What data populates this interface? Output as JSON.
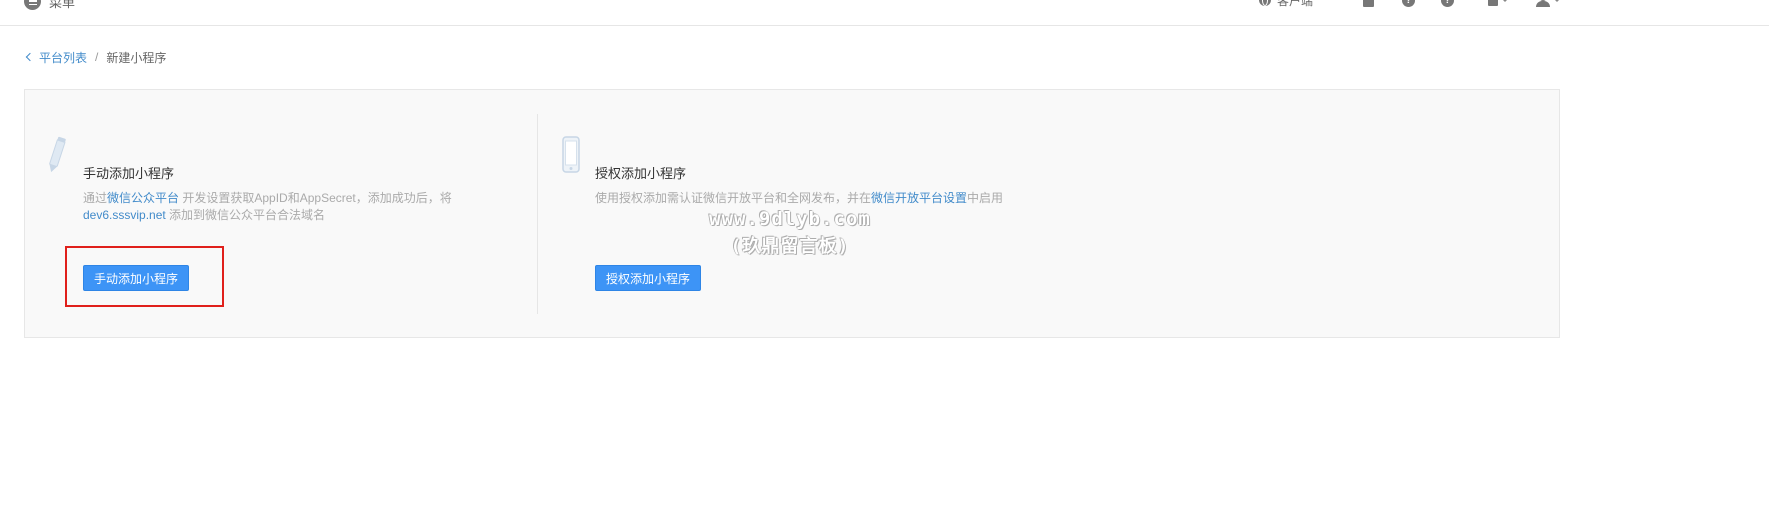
{
  "topbar": {
    "menu_label": "菜单",
    "client_label": "客户端",
    "icons": [
      "menu-icon",
      "globe-icon",
      "calculator-icon",
      "help-icon",
      "help-icon",
      "bell-icon",
      "user-icon"
    ]
  },
  "breadcrumb": {
    "back_label": "平台列表",
    "separator": "/",
    "current": "新建小程序"
  },
  "cards": {
    "manual": {
      "title": "手动添加小程序",
      "desc_prefix": "通过",
      "link1": "微信公众平台",
      "desc_mid": " 开发设置获取AppID和AppSecret，添加成功后，将",
      "link2": "dev6.sssvip.net",
      "desc_suffix": " 添加到微信公众平台合法域名",
      "button": "手动添加小程序",
      "icon": "pencil-icon"
    },
    "auth": {
      "title": "授权添加小程序",
      "desc_prefix": "使用授权添加需认证微信开放平台和全网发布，并在",
      "link": "微信开放平台设置",
      "desc_suffix": "中启用",
      "button": "授权添加小程序",
      "icon": "phone-icon"
    }
  },
  "watermark": {
    "line1": "www.9dlyb.com",
    "line2": "(玖鼎留言板)"
  },
  "colors": {
    "link": "#428bca",
    "primary_button": "#3d94f6",
    "highlight": "#e0201b"
  }
}
